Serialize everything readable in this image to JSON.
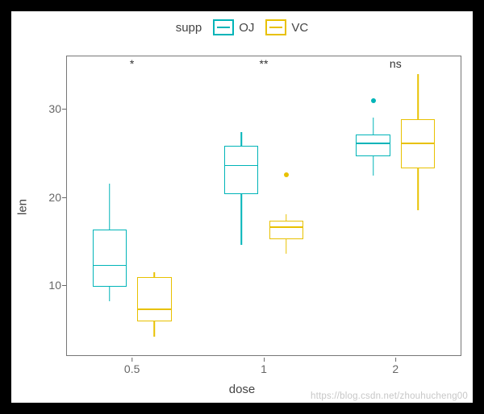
{
  "chart_data": {
    "type": "box",
    "title": "",
    "xlabel": "dose",
    "ylabel": "len",
    "legend_title": "supp",
    "legend_items": [
      {
        "key": "OJ",
        "label": "OJ",
        "color": "#00b4b8"
      },
      {
        "key": "VC",
        "label": "VC",
        "color": "#e8c100"
      }
    ],
    "x_categories": [
      "0.5",
      "1",
      "2"
    ],
    "y_ticks": [
      10,
      20,
      30
    ],
    "ylim": [
      2,
      36
    ],
    "significance": [
      {
        "x": "0.5",
        "label": "*"
      },
      {
        "x": "1",
        "label": "**"
      },
      {
        "x": "2",
        "label": "ns"
      }
    ],
    "series": [
      {
        "name": "OJ",
        "color": "#00b4b8",
        "boxes": [
          {
            "x": "0.5",
            "min": 8.2,
            "q1": 9.8,
            "median": 12.2,
            "q3": 16.3,
            "max": 21.5,
            "outliers": []
          },
          {
            "x": "1",
            "min": 14.6,
            "q1": 20.3,
            "median": 23.5,
            "q3": 25.8,
            "max": 27.3,
            "outliers": []
          },
          {
            "x": "2",
            "min": 22.4,
            "q1": 24.6,
            "median": 26.0,
            "q3": 27.1,
            "max": 29.0,
            "outliers": [
              30.9
            ]
          }
        ]
      },
      {
        "name": "VC",
        "color": "#e8c100",
        "boxes": [
          {
            "x": "0.5",
            "min": 4.2,
            "q1": 5.9,
            "median": 7.2,
            "q3": 10.9,
            "max": 11.5,
            "outliers": []
          },
          {
            "x": "1",
            "min": 13.6,
            "q1": 15.2,
            "median": 16.5,
            "q3": 17.3,
            "max": 18.0,
            "outliers": [
              22.5
            ]
          },
          {
            "x": "2",
            "min": 18.5,
            "q1": 23.2,
            "median": 26.0,
            "q3": 28.8,
            "max": 33.9,
            "outliers": []
          }
        ]
      }
    ]
  },
  "watermark": "https://blog.csdn.net/zhouhucheng00"
}
